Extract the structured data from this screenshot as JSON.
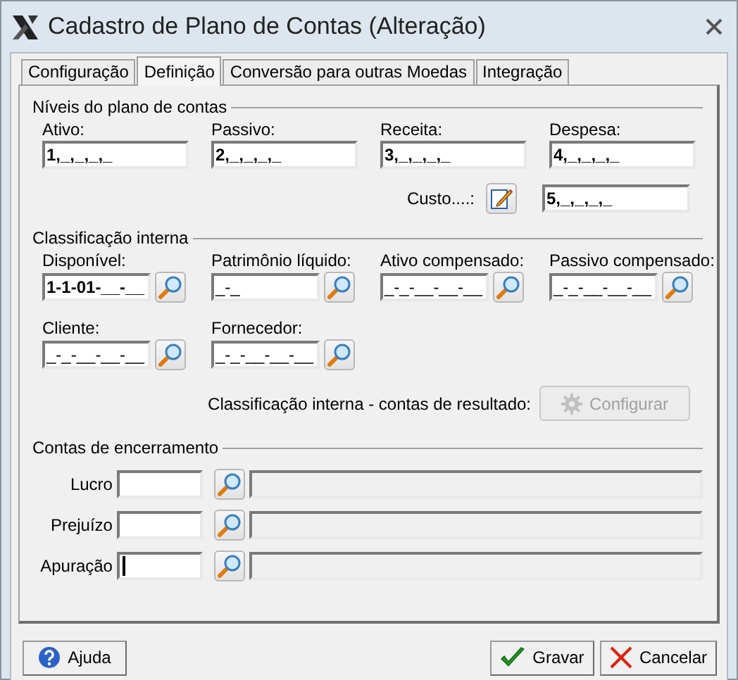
{
  "window": {
    "title": "Cadastro de Plano de Contas (Alteração)"
  },
  "tabs": [
    {
      "label": "Configuração",
      "selected": false
    },
    {
      "label": "Definição",
      "selected": true
    },
    {
      "label": "Conversão para outras Moedas",
      "selected": false
    },
    {
      "label": "Integração",
      "selected": false
    }
  ],
  "levels": {
    "title": "Níveis do plano de contas",
    "fields": [
      {
        "label": "Ativo:",
        "value": "1,_,_,_,_"
      },
      {
        "label": "Passivo:",
        "value": "2,_,_,_,_"
      },
      {
        "label": "Receita:",
        "value": "3,_,_,_,_"
      },
      {
        "label": "Despesa:",
        "value": "4,_,_,_,_"
      }
    ],
    "custo": {
      "label": "Custo....:",
      "value": "5,_,_,_,_"
    }
  },
  "classification": {
    "title": "Classificação interna",
    "fields": [
      {
        "label": "Disponível:",
        "value": "1-1-01-__-__",
        "bold": true
      },
      {
        "label": "Patrimônio líquido:",
        "value": "_-_",
        "bold": false
      },
      {
        "label": "Ativo compensado:",
        "value": "_-_-__-__-__",
        "bold": false
      },
      {
        "label": "Passivo compensado:",
        "value": "_-_-__-__-__",
        "bold": false
      },
      {
        "label": "Cliente:",
        "value": "_-_-__-__-__",
        "bold": false
      },
      {
        "label": "Fornecedor:",
        "value": "_-_-__-__-__",
        "bold": false
      }
    ],
    "result_label": "Classificação interna - contas de resultado:",
    "configure_button": {
      "label": "Configurar",
      "disabled": true
    }
  },
  "closing": {
    "title": "Contas de encerramento",
    "rows": [
      {
        "label": "Lucro",
        "focused": false
      },
      {
        "label": "Prejuízo",
        "focused": false
      },
      {
        "label": "Apuração",
        "focused": true
      }
    ]
  },
  "buttons": [
    {
      "label": "Ajuda",
      "kind": "help"
    },
    {
      "label": "Gravar",
      "kind": "save"
    },
    {
      "label": "Cancelar",
      "kind": "cancel"
    }
  ]
}
